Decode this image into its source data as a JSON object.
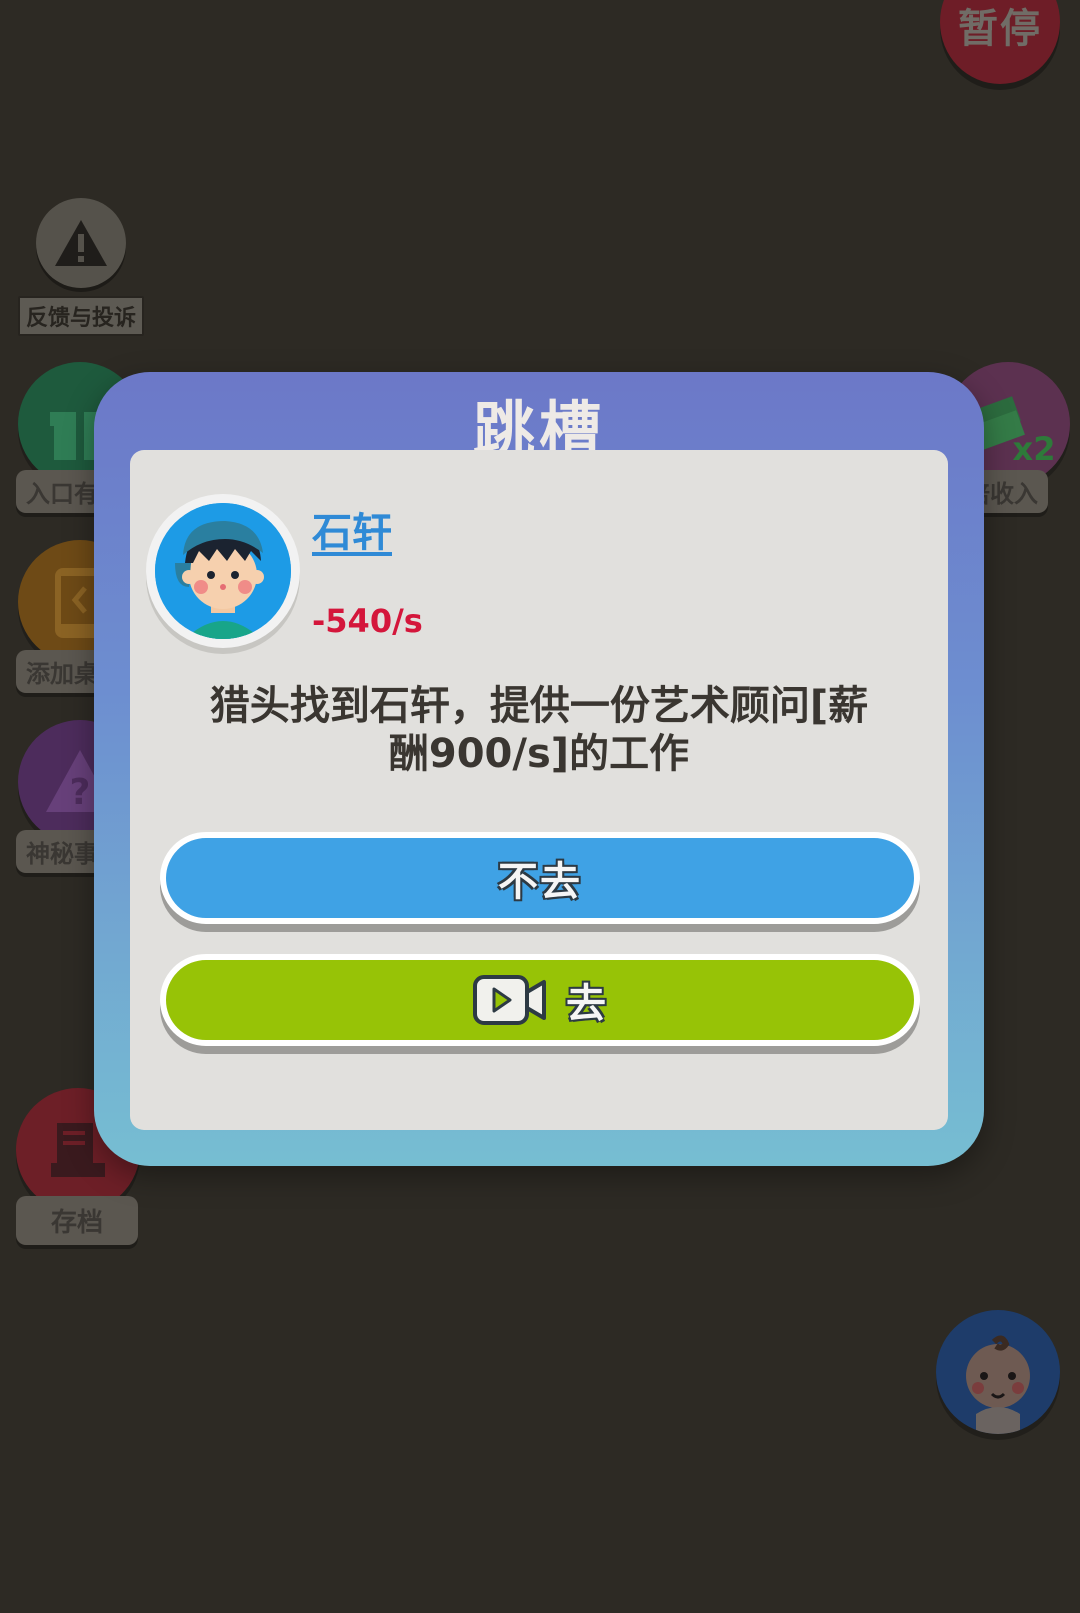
{
  "top_right": {
    "pause_label": "暂停"
  },
  "left_menu": {
    "feedback_label": "反馈与投诉",
    "gift_label": "入口有",
    "desktop_label": "添加桌",
    "mystery_label": "神秘事",
    "save_label": "存档"
  },
  "right_menu": {
    "double_income_label": "倍收入",
    "double_badge": "x2"
  },
  "modal": {
    "title": "跳槽",
    "character_name": "石轩",
    "current_salary": "-540/s",
    "event_line1": "猎头找到石轩，提供一份艺术顾问[薪",
    "event_line2": "酬900/s]的工作",
    "decline_label": "不去",
    "accept_label": "去"
  },
  "icons": {
    "feedback": "warning-icon",
    "gift": "gift-icon",
    "desktop": "phone-add-icon",
    "mystery": "question-icon",
    "save": "document-icon",
    "double": "money-stack-icon",
    "baby": "baby-avatar-icon",
    "video": "video-ad-icon"
  },
  "colors": {
    "modal_gradient_top": "#6c78c8",
    "modal_gradient_bottom": "#76bed2",
    "panel": "#e1e0dd",
    "decline": "#3fa2e5",
    "accept": "#97c306",
    "name": "#2f8ad6",
    "salary": "#d4163b"
  }
}
